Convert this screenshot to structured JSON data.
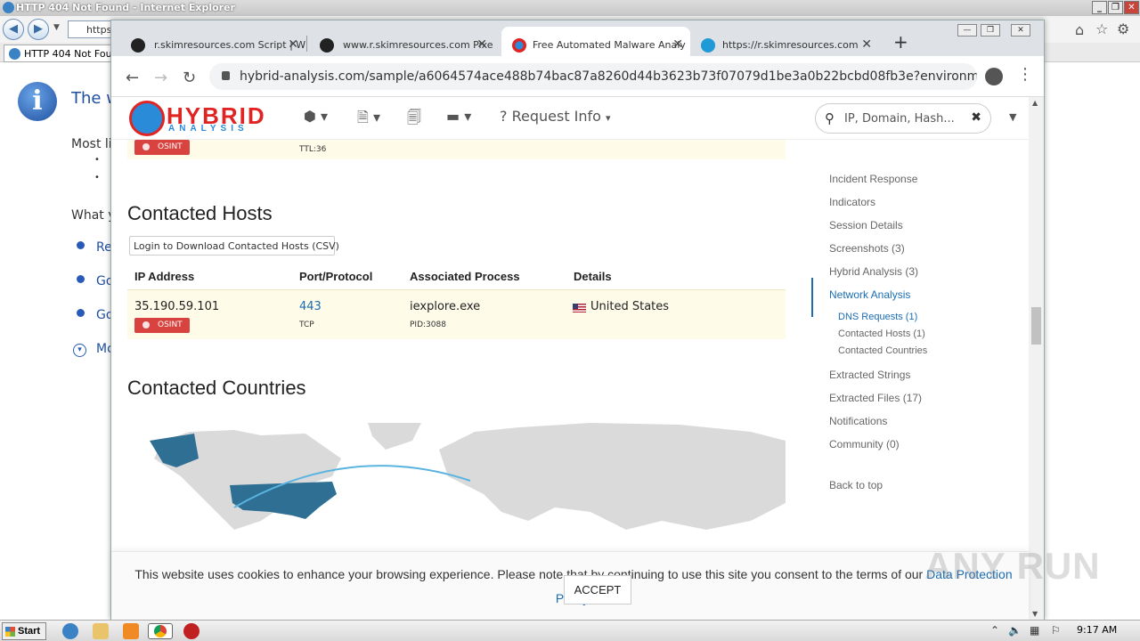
{
  "ie": {
    "title": "HTTP 404 Not Found - Internet Explorer",
    "address_text": "https",
    "tab_label": "HTTP 404 Not Found",
    "page_heading": "The w",
    "lines": [
      "Most li",
      "What y"
    ],
    "links": [
      "Re",
      "Go",
      "Go",
      "Mo"
    ]
  },
  "chrome": {
    "tabs": [
      {
        "label": "r.skimresources.com Script | W",
        "favicon": "spy-icon"
      },
      {
        "label": "www.r.skimresources.com Pixe",
        "favicon": "spy-icon"
      },
      {
        "label": "Free Automated Malware Analy",
        "favicon": "hybrid-analysis-icon",
        "active": true
      },
      {
        "label": "https://r.skimresources.com",
        "favicon": "globe-icon"
      }
    ],
    "url": "hybrid-analysis.com/sample/a6064574ace488b74bac87a8260d44b3623b73f07079d1be3a0b22bcbd08fb3e?environmentId=..."
  },
  "site": {
    "logo_text": "HYBRID",
    "logo_sub": "ANALYSIS",
    "nav_request_info": "Request Info",
    "search_placeholder": "IP, Domain, Hash...",
    "top_row_ttl": "TTL:36",
    "osint_label": "OSINT",
    "contacted_hosts_title": "Contacted Hosts",
    "csv_button": "Login to Download Contacted Hosts (CSV)",
    "table_headers": [
      "IP Address",
      "Port/Protocol",
      "Associated Process",
      "Details"
    ],
    "host": {
      "ip": "35.190.59.101",
      "port": "443",
      "protocol": "TCP",
      "process": "iexplore.exe",
      "pid": "PID:3088",
      "country": "United States"
    },
    "contacted_countries_title": "Contacted Countries",
    "map_highlight_color": "#2f6f94"
  },
  "sidenav": {
    "items": [
      {
        "label": "Incident Response"
      },
      {
        "label": "Indicators"
      },
      {
        "label": "Session Details"
      },
      {
        "label": "Screenshots (3)"
      },
      {
        "label": "Hybrid Analysis (3)"
      },
      {
        "label": "Network Analysis",
        "active": true
      },
      {
        "label": "DNS Requests (1)",
        "sub": true
      },
      {
        "label": "Contacted Hosts (1)",
        "sub": true
      },
      {
        "label": "Contacted Countries",
        "sub": true
      },
      {
        "label": "Extracted Strings"
      },
      {
        "label": "Extracted Files (17)"
      },
      {
        "label": "Notifications"
      },
      {
        "label": "Community (0)"
      },
      {
        "label": "Back to top"
      }
    ]
  },
  "cookie": {
    "text": "This website uses cookies to enhance your browsing experience. Please note that by continuing to use this site you consent to the terms of our ",
    "link": "Data Protection Policy",
    "end": ".",
    "accept": "ACCEPT"
  },
  "watermark": "ANY RUN",
  "taskbar": {
    "start": "Start",
    "clock": "9:17 AM"
  }
}
